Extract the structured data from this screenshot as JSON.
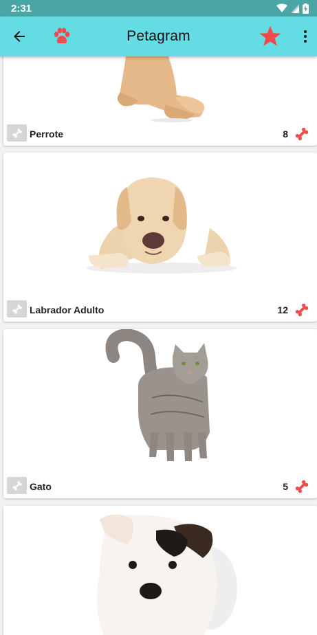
{
  "status_bar": {
    "time": "2:31"
  },
  "app_bar": {
    "title": "Petagram"
  },
  "colors": {
    "status_bar": "#4aa5a6",
    "app_bar": "#63dce3",
    "accent_red": "#ef4b4b",
    "card_bg": "#ffffff"
  },
  "pets": [
    {
      "name": "Perrote",
      "likes": "8"
    },
    {
      "name": "Labrador Adulto",
      "likes": "12"
    },
    {
      "name": "Gato",
      "likes": "5"
    }
  ]
}
